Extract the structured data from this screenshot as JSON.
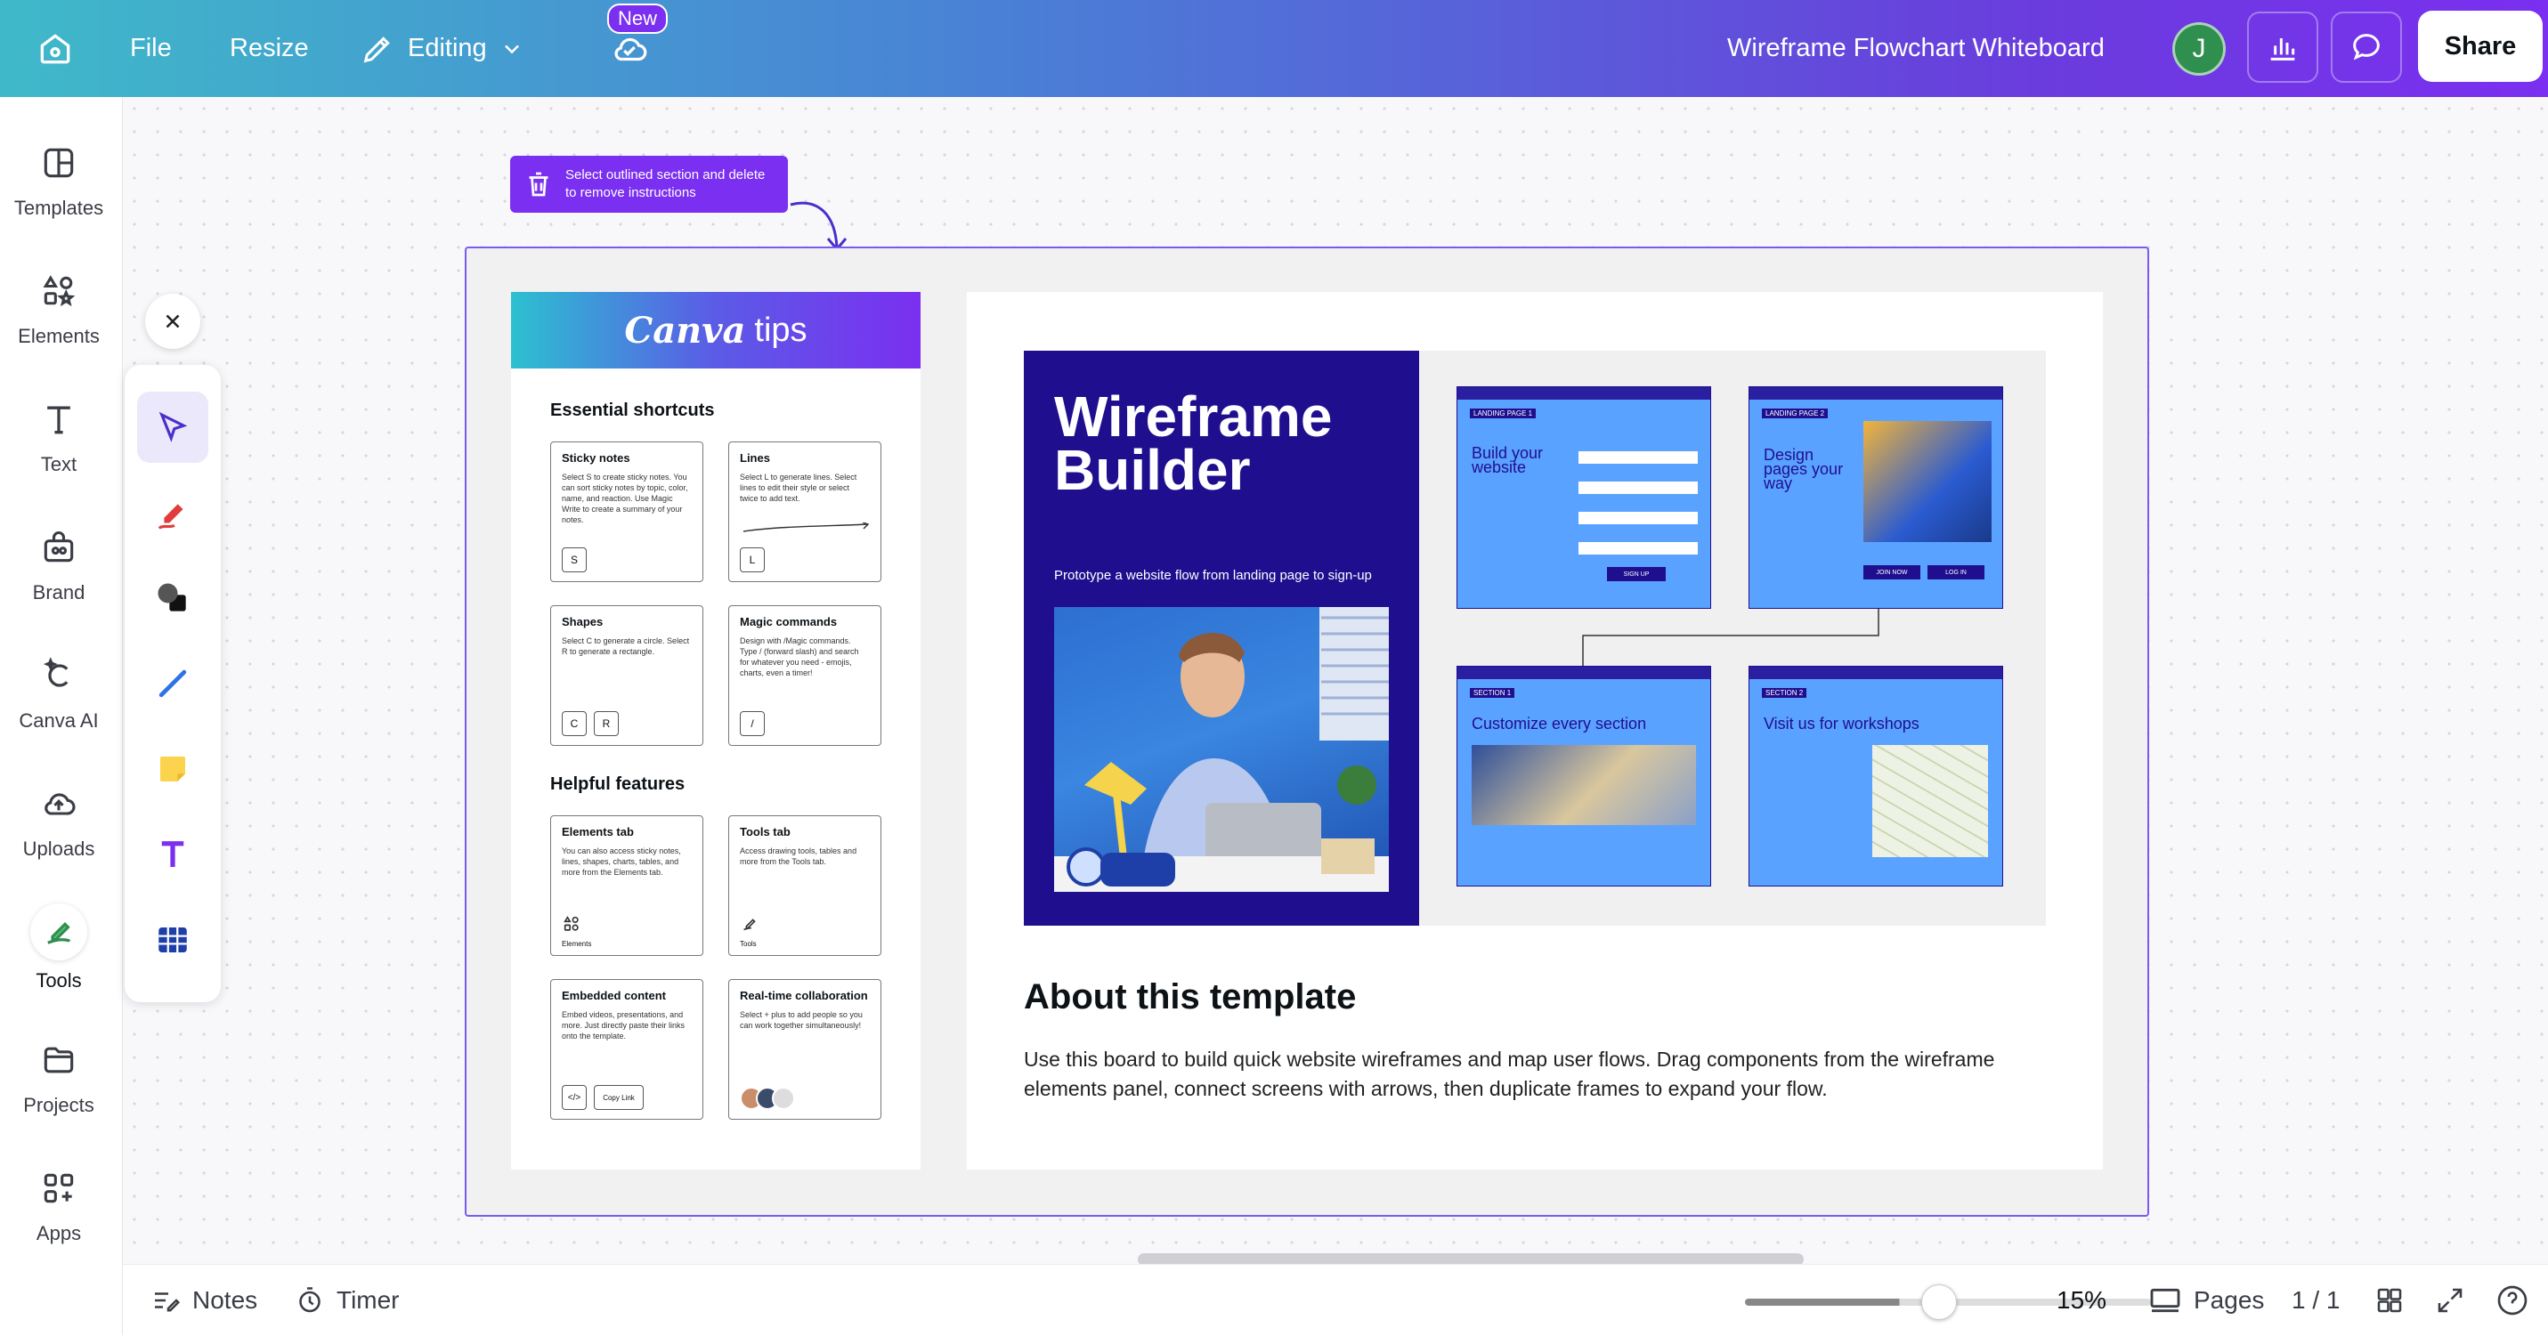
{
  "topbar": {
    "file_label": "File",
    "resize_label": "Resize",
    "editing_label": "Editing",
    "new_badge": "New",
    "doc_title": "Wireframe Flowchart Whiteboard",
    "avatar_initial": "J",
    "share_label": "Share"
  },
  "sidebar": {
    "items": [
      {
        "label": "Templates"
      },
      {
        "label": "Elements"
      },
      {
        "label": "Text"
      },
      {
        "label": "Brand"
      },
      {
        "label": "Canva AI"
      },
      {
        "label": "Uploads"
      },
      {
        "label": "Tools"
      },
      {
        "label": "Projects"
      },
      {
        "label": "Apps"
      }
    ]
  },
  "instruction": "Select outlined section and delete to remove instructions",
  "tips": {
    "brand": "Canva",
    "title": "tips",
    "essential": "Essential shortcuts",
    "helpful": "Helpful features",
    "cards": [
      {
        "title": "Sticky notes",
        "desc": "Select S to create sticky notes. You can sort sticky notes by topic, color, name, and reaction. Use Magic Write to create a summary of your notes.",
        "keys": [
          "S"
        ]
      },
      {
        "title": "Lines",
        "desc": "Select L to generate lines. Select lines to edit their style or select twice to add text.",
        "keys": [
          "L"
        ]
      },
      {
        "title": "Shapes",
        "desc": "Select C to generate a circle. Select R to generate a rectangle.",
        "keys": [
          "C",
          "R"
        ]
      },
      {
        "title": "Magic commands",
        "desc": "Design with /Magic commands. Type / (forward slash) and search for whatever you need - emojis, charts, even a timer!",
        "keys": [
          "/"
        ]
      },
      {
        "title": "Elements tab",
        "desc": "You can also access sticky notes, lines, shapes, charts, tables, and more from the Elements tab.",
        "icon_label": "Elements"
      },
      {
        "title": "Tools tab",
        "desc": "Access drawing tools, tables and more from the Tools tab.",
        "icon_label": "Tools"
      },
      {
        "title": "Embedded content",
        "desc": "Embed videos, presentations, and more. Just directly paste their links onto the template.",
        "keys": [
          "</>"
        ],
        "extra": "Copy Link"
      },
      {
        "title": "Real-time collaboration",
        "desc": "Select + plus to add people so you can work together simultaneously!"
      }
    ]
  },
  "template": {
    "wf_title_1": "Wireframe",
    "wf_title_2": "Builder",
    "wf_sub": "Prototype a website flow from landing page to sign-up",
    "screens": [
      {
        "label": "LANDING PAGE 1",
        "heading": "Build your website",
        "button": "SIGN UP"
      },
      {
        "label": "LANDING PAGE 2",
        "heading": "Design pages your way",
        "buttons": [
          "JOIN NOW",
          "LOG IN"
        ]
      },
      {
        "label": "SECTION 1",
        "heading": "Customize every section"
      },
      {
        "label": "SECTION 2",
        "heading": "Visit us for workshops"
      }
    ],
    "about_title": "About this template",
    "about_desc": "Use this board to build quick website wireframes and map user flows. Drag components from the wireframe elements panel, connect screens with arrows, then duplicate frames to expand your flow."
  },
  "bottombar": {
    "notes_label": "Notes",
    "timer_label": "Timer",
    "zoom": "15%",
    "zoom_fraction": 0.17,
    "pages_label": "Pages",
    "page_count": "1 / 1"
  },
  "colors": {
    "accent": "#7b2ff0",
    "wireframe_dark": "#1f0f8f",
    "wireframe_screen": "#5aa2ff"
  }
}
